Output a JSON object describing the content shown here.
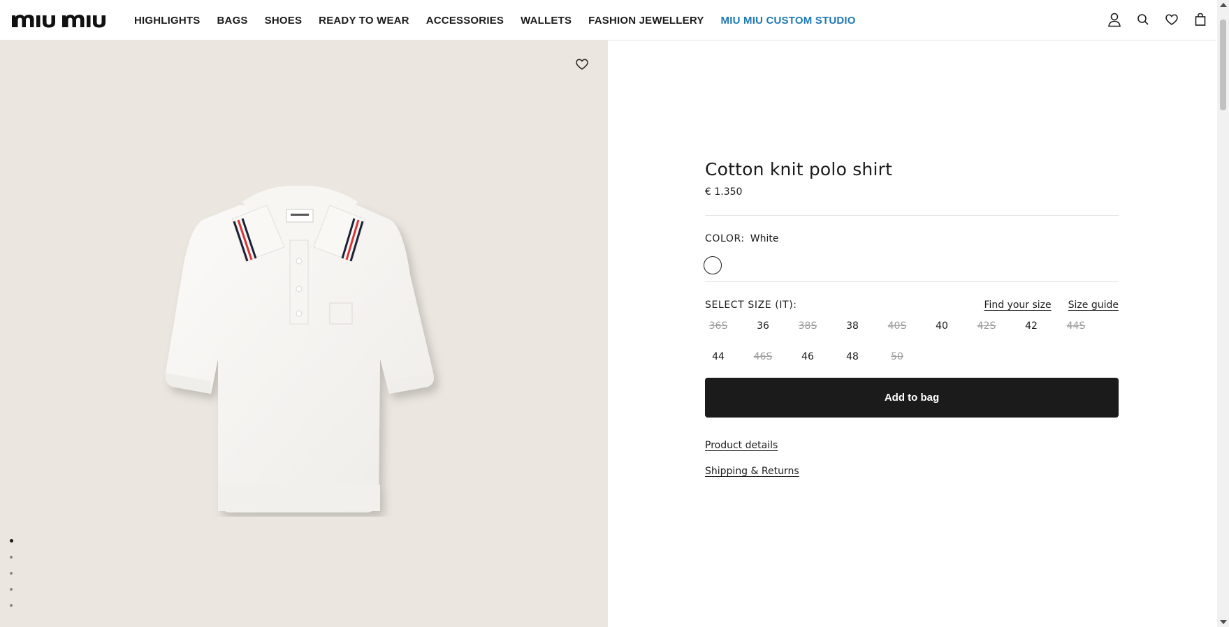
{
  "brand": {
    "logo_text": "miu miu"
  },
  "nav": {
    "items": [
      {
        "label": "HIGHLIGHTS"
      },
      {
        "label": "BAGS"
      },
      {
        "label": "SHOES"
      },
      {
        "label": "READY TO WEAR"
      },
      {
        "label": "ACCESSORIES"
      },
      {
        "label": "WALLETS"
      },
      {
        "label": "FASHION JEWELLERY"
      },
      {
        "label": "MIU MIU CUSTOM STUDIO"
      }
    ],
    "accent_color": "#1e79b4"
  },
  "header_icons": [
    "account-icon",
    "search-icon",
    "wishlist-icon",
    "bag-icon"
  ],
  "gallery": {
    "slides_total": 5,
    "active_slide": 1,
    "background_color": "#ebe6df"
  },
  "product": {
    "title": "Cotton knit polo shirt",
    "price": "€ 1.350",
    "color_label": "COLOR:",
    "color_value": "White",
    "size_label": "SELECT SIZE (IT):",
    "find_size": "Find your size",
    "size_guide": "Size guide",
    "sizes": [
      {
        "label": "36S",
        "available": false
      },
      {
        "label": "36",
        "available": true
      },
      {
        "label": "38S",
        "available": false
      },
      {
        "label": "38",
        "available": true
      },
      {
        "label": "40S",
        "available": false
      },
      {
        "label": "40",
        "available": true
      },
      {
        "label": "42S",
        "available": false
      },
      {
        "label": "42",
        "available": true
      },
      {
        "label": "44S",
        "available": false
      },
      {
        "label": "44",
        "available": true
      },
      {
        "label": "46S",
        "available": false
      },
      {
        "label": "46",
        "available": true
      },
      {
        "label": "48",
        "available": true
      },
      {
        "label": "50",
        "available": false
      }
    ],
    "add_to_bag": "Add to bag",
    "details_link": "Product details",
    "shipping_link": "Shipping & Returns"
  },
  "colors": {
    "text": "#1b1b1b",
    "button": "#1b1b1b",
    "unavailable": "#9b9b9b"
  }
}
